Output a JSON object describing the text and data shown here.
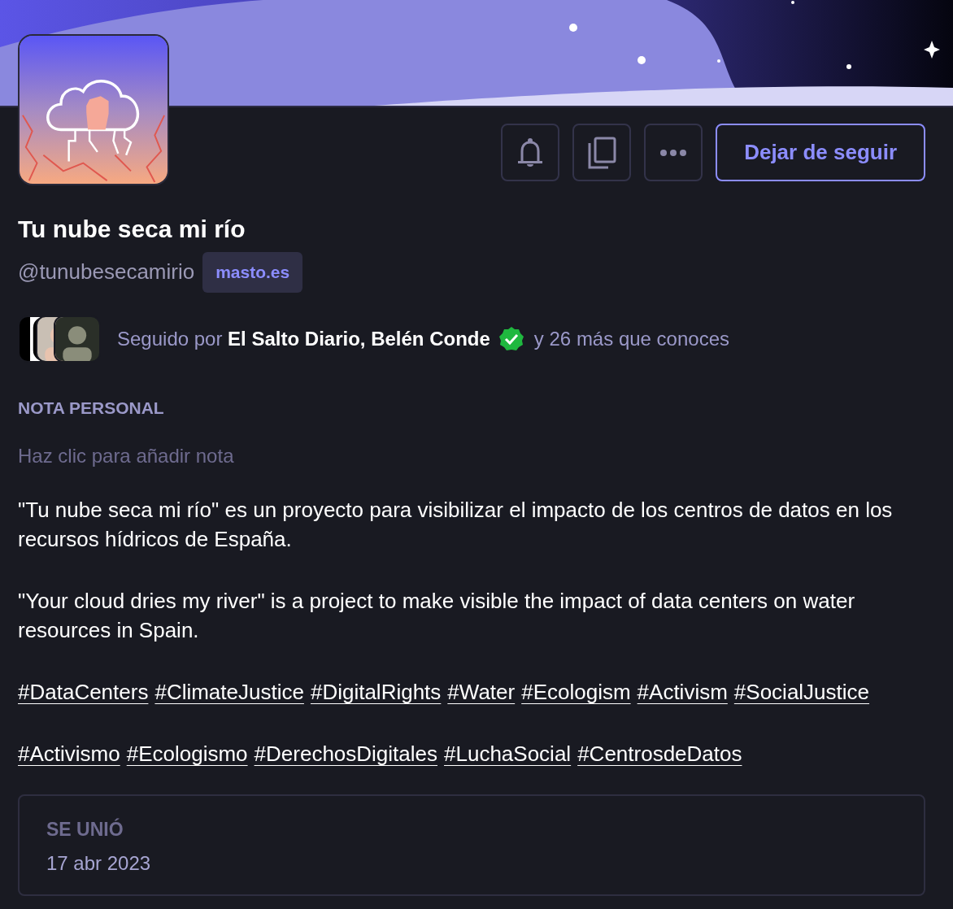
{
  "profile": {
    "display_name": "Tu nube seca mi río",
    "handle": "@tunubesecamirio",
    "domain": "masto.es"
  },
  "actions": [
    {
      "kind": "bell"
    },
    {
      "kind": "copy"
    },
    {
      "kind": "more"
    }
  ],
  "follow_button": "Dejar de seguir",
  "followed_by": {
    "names": "Seguido por **El Salto Diario, Belén Conde**",
    "verified": true,
    "rest": "y 26 más que conoces"
  },
  "note": {
    "label": "NOTA PERSONAL",
    "placeholder": "Haz clic para añadir nota"
  },
  "bio": [
    "\"Tu nube seca mi río\" es un proyecto para visibilizar el impacto de los centros de datos en los recursos hídricos de España.",
    "\"Your cloud dries my river\" is a project to make visible the impact of data centers on water resources in Spain."
  ],
  "hashtag_groups": [
    [
      "#DataCenters",
      "#ClimateJustice",
      "#DigitalRights",
      "#Water",
      "#Ecologism",
      "#Activism",
      "#SocialJustice"
    ],
    [
      "#Activismo",
      "#Ecologismo",
      "#DerechosDigitales",
      "#LuchaSocial",
      "#CentrosdeDatos"
    ]
  ],
  "joined": {
    "label": "SE UNIÓ",
    "date": "17 abr 2023"
  }
}
